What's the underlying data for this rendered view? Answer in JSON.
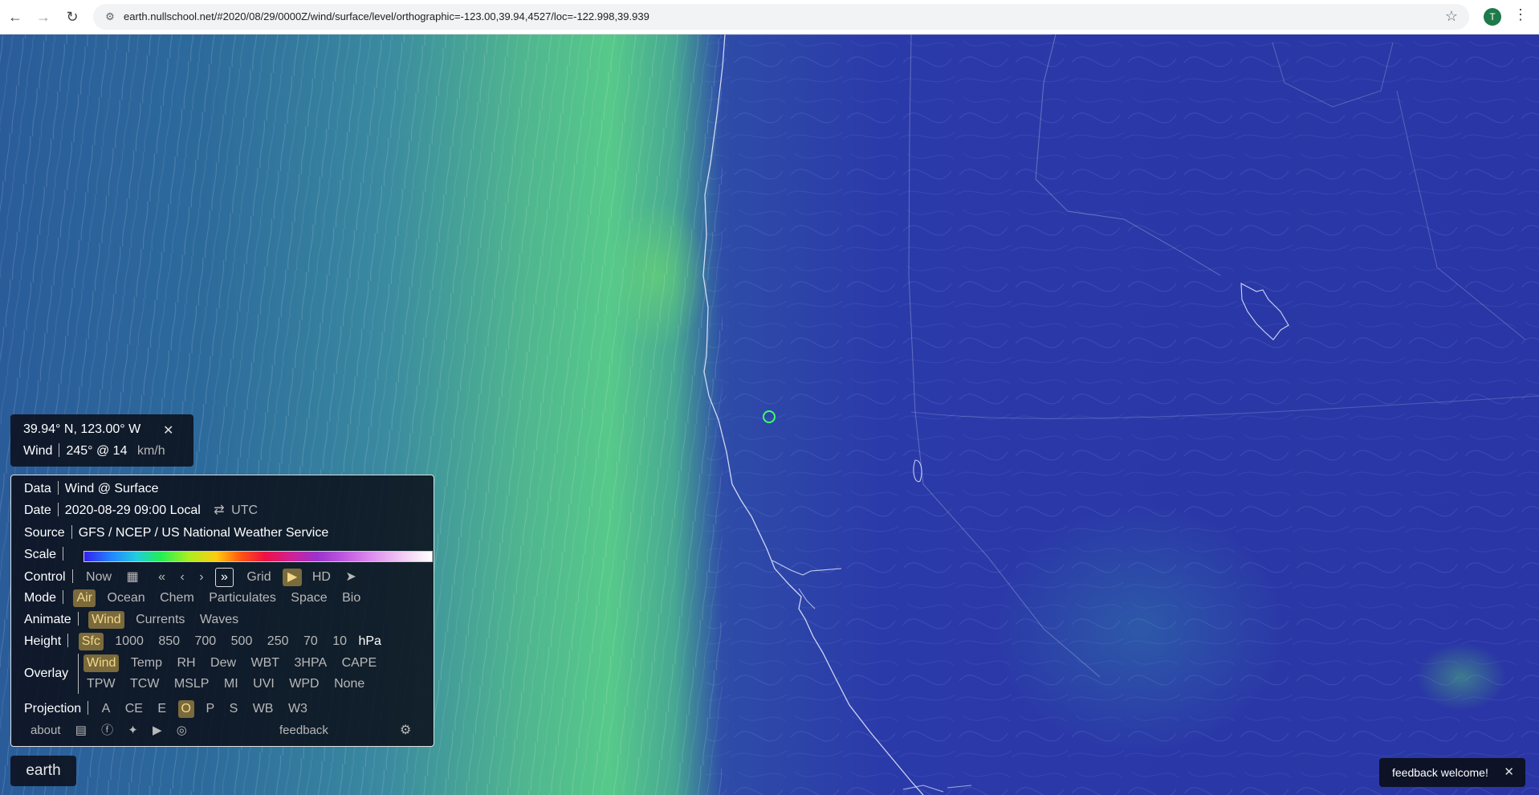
{
  "browser": {
    "url": "earth.nullschool.net/#2020/08/29/0000Z/wind/surface/level/orthographic=-123.00,39.94,4527/loc=-122.998,39.939",
    "avatar_letter": "T",
    "back_icon": "arrow-left-icon",
    "forward_icon": "arrow-right-icon",
    "reload_icon": "reload-icon"
  },
  "spot": {
    "coords": "39.94° N, 123.00° W",
    "close": "✕",
    "wind_label": "Wind",
    "wind_value": "245° @ 14",
    "wind_unit": "km/h"
  },
  "menu": {
    "data_label": "Data",
    "data_value": "Wind @ Surface",
    "date_label": "Date",
    "date_value": "2020-08-29 09:00 Local",
    "date_swap": "⇄",
    "date_utc": "UTC",
    "source_label": "Source",
    "source_value": "GFS / NCEP / US National Weather Service",
    "scale_label": "Scale",
    "control_label": "Control",
    "control": {
      "now": "Now",
      "calendar": "▦",
      "fast_back": "«",
      "back": "‹",
      "forward": "›",
      "fast_forward": "»",
      "grid": "Grid",
      "play": "▶",
      "hd": "HD",
      "locate": "➤"
    },
    "mode_label": "Mode",
    "modes": [
      "Air",
      "Ocean",
      "Chem",
      "Particulates",
      "Space",
      "Bio"
    ],
    "animate_label": "Animate",
    "animates": [
      "Wind",
      "Currents",
      "Waves"
    ],
    "height_label": "Height",
    "heights": [
      "Sfc",
      "1000",
      "850",
      "700",
      "500",
      "250",
      "70",
      "10"
    ],
    "height_unit": "hPa",
    "overlay_label": "Overlay",
    "overlays_row1": [
      "Wind",
      "Temp",
      "RH",
      "Dew",
      "WBT",
      "3HPA",
      "CAPE"
    ],
    "overlays_row2": [
      "TPW",
      "TCW",
      "MSLP",
      "MI",
      "UVI",
      "WPD",
      "None"
    ],
    "projection_label": "Projection",
    "projections": [
      "A",
      "CE",
      "E",
      "O",
      "P",
      "S",
      "WB",
      "W3"
    ],
    "about": "about",
    "feedback": "feedback"
  },
  "earth_button": "earth",
  "toast": {
    "text": "feedback welcome!",
    "close": "✕"
  }
}
